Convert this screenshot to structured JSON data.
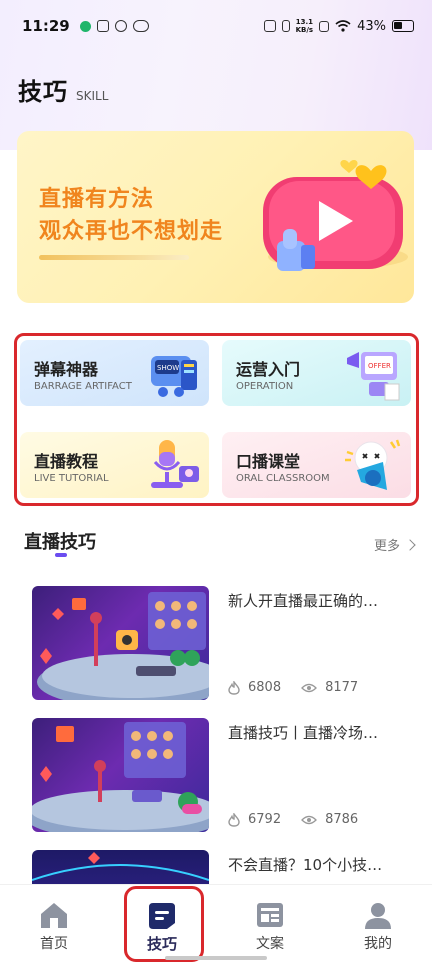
{
  "status_bar": {
    "time": "11:29",
    "speed_top": "13.1",
    "speed_bottom": "KB/s",
    "battery": "43%"
  },
  "header": {
    "title": "技巧",
    "subtitle": "SKILL"
  },
  "banner": {
    "line1": "直播有方法",
    "line2": "观众再也不想划走"
  },
  "features": [
    {
      "title": "弹幕神器",
      "subtitle": "BARRAGE ARTIFACT"
    },
    {
      "title": "运营入门",
      "subtitle": "OPERATION"
    },
    {
      "title": "直播教程",
      "subtitle": "LIVE TUTORIAL"
    },
    {
      "title": "口播课堂",
      "subtitle": "ORAL CLASSROOM"
    }
  ],
  "section": {
    "title": "直播技巧",
    "more": "更多"
  },
  "articles": [
    {
      "title": "新人开直播最正确的…",
      "likes": "6808",
      "views": "8177"
    },
    {
      "title": "直播技巧丨直播冷场…",
      "likes": "6792",
      "views": "8786"
    },
    {
      "title": "不会直播？10个小技…",
      "likes": "",
      "views": ""
    }
  ],
  "nav": {
    "items": [
      {
        "label": "首页",
        "icon": "home-icon"
      },
      {
        "label": "技巧",
        "icon": "skill-icon",
        "active": true
      },
      {
        "label": "文案",
        "icon": "copywriting-icon"
      },
      {
        "label": "我的",
        "icon": "profile-icon"
      }
    ]
  },
  "colors": {
    "accent": "#6b4df0",
    "highlight_box": "#d9282c",
    "banner_text": "#f0851e"
  }
}
